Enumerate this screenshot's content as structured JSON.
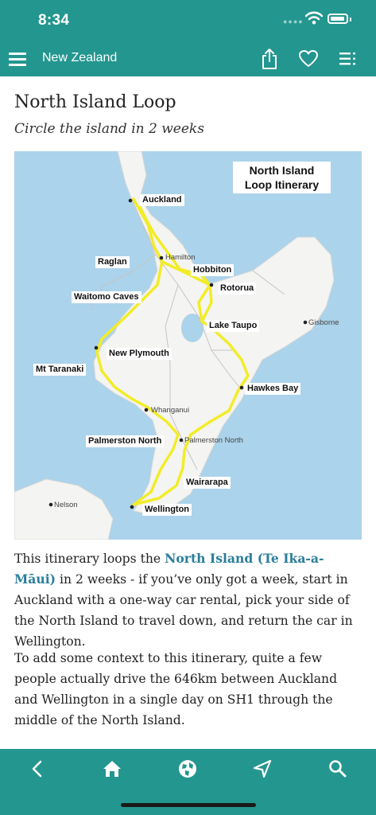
{
  "status_bar": {
    "time": "8:34"
  },
  "nav": {
    "title": "New Zealand",
    "icons": [
      "menu-icon",
      "share-icon",
      "heart-icon",
      "toc-list-icon"
    ]
  },
  "article": {
    "title": "North Island Loop",
    "subtitle": "Circle the island in 2 weeks"
  },
  "map": {
    "title_line1": "North Island",
    "title_line2": "Loop Itinerary",
    "route_color": "#f2ec28",
    "places": {
      "auckland": "Auckland",
      "hobbiton": "Hobbiton",
      "raglan": "Raglan",
      "rotorua": "Rotorua",
      "waitomo": "Waitomo Caves",
      "lake_taupo": "Lake Taupo",
      "new_plymouth": "New Plymouth",
      "mt_taranaki": "Mt Taranaki",
      "hawkes_bay": "Hawkes Bay",
      "palmerston_north": "Palmerston North",
      "wairarapa": "Wairarapa",
      "wellington": "Wellington"
    },
    "towns": {
      "hamilton": "Hamilton",
      "gisborne": "Gisborne",
      "whanganui": "Whanganui",
      "palmerston_north": "Palmerston North",
      "nelson": "Nelson"
    }
  },
  "body": {
    "p1_before": "This itinerary loops the ",
    "p1_link": "North Island (Te Ika-a-Māui)",
    "p1_after": " in 2 weeks - if you’ve only got a week, start in Auckland with a one-way car rental, pick your side of the North Island to travel down, and return the car in Wellington.",
    "p2": "To add some context to this itinerary, quite a few people actually drive the 646km between Auckland and Wellington in a single day on SH1 through the middle of the North Island."
  },
  "bottom_bar": {
    "tabs": [
      "back-icon",
      "home-icon",
      "globe-icon",
      "location-arrow-icon",
      "search-icon"
    ]
  },
  "colors": {
    "brand": "#23968f",
    "link": "#2a7e9a",
    "water": "#abd3eb",
    "land": "#f4f4f2"
  }
}
